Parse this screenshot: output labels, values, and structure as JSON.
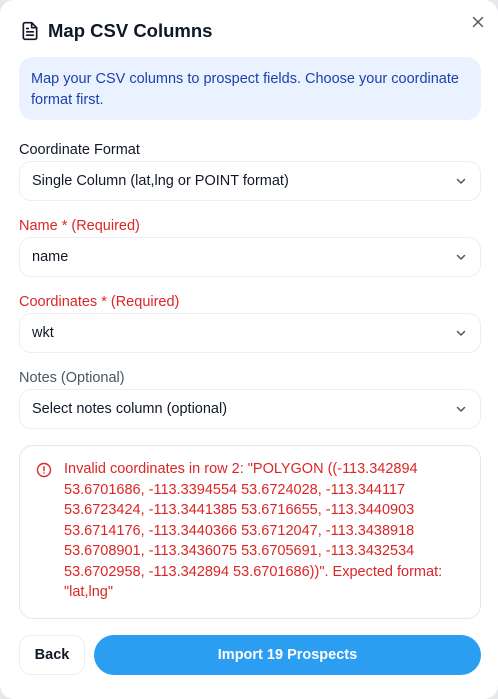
{
  "dialog": {
    "title": "Map CSV Columns",
    "info": "Map your CSV columns to prospect fields. Choose your coordinate format first."
  },
  "fields": {
    "coordinate_format": {
      "label": "Coordinate Format",
      "value": "Single Column (lat,lng or POINT format)"
    },
    "name": {
      "label": "Name * (Required)",
      "value": "name"
    },
    "coordinates": {
      "label": "Coordinates * (Required)",
      "value": "wkt"
    },
    "notes": {
      "label": "Notes (Optional)",
      "value": "Select notes column (optional)"
    }
  },
  "error": {
    "message": "Invalid coordinates in row 2: \"POLYGON ((-113.342894 53.6701686, -113.3394554 53.6724028, -113.344117 53.6723424, -113.3441385 53.6716655, -113.3440903 53.6714176, -113.3440366 53.6712047, -113.3438918 53.6708901, -113.3436075 53.6705691, -113.3432534 53.6702958, -113.342894 53.6701686))\". Expected format: \"lat,lng\""
  },
  "footer": {
    "back_label": "Back",
    "import_label": "Import 19 Prospects"
  },
  "icons": {
    "title_icon": "document-icon",
    "close_icon": "close-icon",
    "chevron_icon": "chevron-down-icon",
    "alert_icon": "alert-circle-icon"
  },
  "colors": {
    "accent": "#2c9ef1",
    "error": "#dc2626",
    "info_bg": "#e9f2fe",
    "info_text": "#1e40af"
  }
}
